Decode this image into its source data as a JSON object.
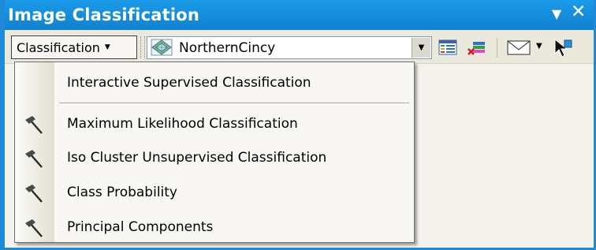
{
  "window": {
    "title": "Image Classification",
    "title_controls": {
      "dropdown": "▼",
      "close": "✕"
    }
  },
  "toolbar": {
    "classification_menu_label": "Classification",
    "layer_value": "NorthernCincy"
  },
  "menu": {
    "items": [
      {
        "label": "Interactive Supervised Classification",
        "icon": null
      },
      {
        "label": "Maximum Likelihood Classification",
        "icon": "hammer-icon"
      },
      {
        "label": "Iso Cluster Unsupervised Classification",
        "icon": "hammer-icon"
      },
      {
        "label": "Class Probability",
        "icon": "hammer-icon"
      },
      {
        "label": "Principal Components",
        "icon": "hammer-icon"
      }
    ]
  },
  "colors": {
    "title_bar": "#1b9be8",
    "menu_background": "#f8f7f3",
    "toolbar_background": "#ebe8dc"
  }
}
